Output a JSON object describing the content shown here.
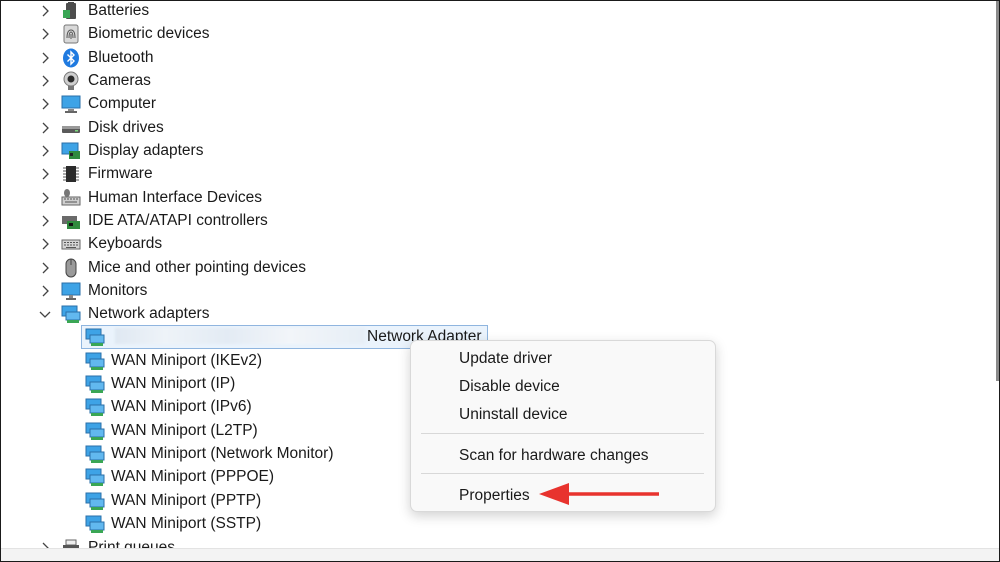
{
  "tree": {
    "categories": [
      {
        "label": "Batteries",
        "icon": "battery-icon"
      },
      {
        "label": "Biometric devices",
        "icon": "fingerprint-icon"
      },
      {
        "label": "Bluetooth",
        "icon": "bluetooth-icon"
      },
      {
        "label": "Cameras",
        "icon": "camera-icon"
      },
      {
        "label": "Computer",
        "icon": "computer-icon"
      },
      {
        "label": "Disk drives",
        "icon": "disk-drive-icon"
      },
      {
        "label": "Display adapters",
        "icon": "display-adapter-icon"
      },
      {
        "label": "Firmware",
        "icon": "firmware-chip-icon"
      },
      {
        "label": "Human Interface Devices",
        "icon": "hid-keyboard-icon"
      },
      {
        "label": "IDE ATA/ATAPI controllers",
        "icon": "ide-controller-icon"
      },
      {
        "label": "Keyboards",
        "icon": "keyboard-icon"
      },
      {
        "label": "Mice and other pointing devices",
        "icon": "mouse-icon"
      },
      {
        "label": "Monitors",
        "icon": "monitor-icon"
      },
      {
        "label": "Network adapters",
        "icon": "network-adapter-icon",
        "expanded": true
      }
    ],
    "network_children": [
      {
        "label": "Network Adapter",
        "selected": true,
        "name_obscured": true
      },
      {
        "label": "WAN Miniport (IKEv2)"
      },
      {
        "label": "WAN Miniport (IP)"
      },
      {
        "label": "WAN Miniport (IPv6)"
      },
      {
        "label": "WAN Miniport (L2TP)"
      },
      {
        "label": "WAN Miniport (Network Monitor)"
      },
      {
        "label": "WAN Miniport (PPPOE)"
      },
      {
        "label": "WAN Miniport (PPTP)"
      },
      {
        "label": "WAN Miniport (SSTP)"
      }
    ],
    "next_category": {
      "label": "Print queues",
      "icon": "printer-icon"
    }
  },
  "context_menu": {
    "items": [
      "Update driver",
      "Disable device",
      "Uninstall device",
      "Scan for hardware changes",
      "Properties"
    ],
    "highlighted": "Properties"
  },
  "colors": {
    "annotation_arrow": "#e8332e",
    "selection_border": "#8fb5df",
    "selection_fill": "#eaf3fc",
    "menu_background": "#f9f9f9"
  }
}
